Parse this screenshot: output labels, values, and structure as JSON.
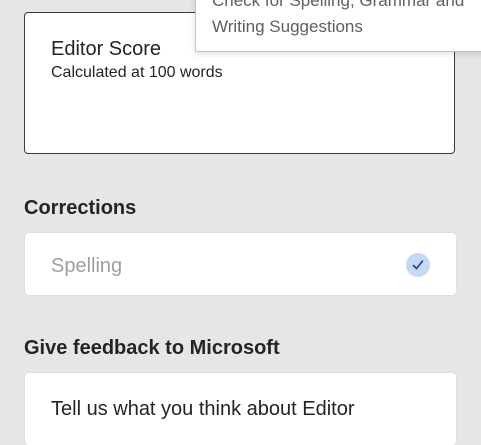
{
  "editor_score": {
    "title": "Editor Score",
    "subtitle": "Calculated at 100 words"
  },
  "tooltip": {
    "text": "Check for Spelling, Grammar and\nWriting Suggestions"
  },
  "corrections": {
    "heading": "Corrections",
    "items": [
      {
        "label": "Spelling",
        "icon": "checkmark-icon",
        "status": "complete"
      }
    ]
  },
  "feedback": {
    "heading": "Give feedback to Microsoft",
    "link_label": "Tell us what you think about Editor"
  },
  "colors": {
    "accent": "#1f3e99",
    "check_badge_bg": "#c7d9f2",
    "panel_bg": "#e6e6e6"
  }
}
